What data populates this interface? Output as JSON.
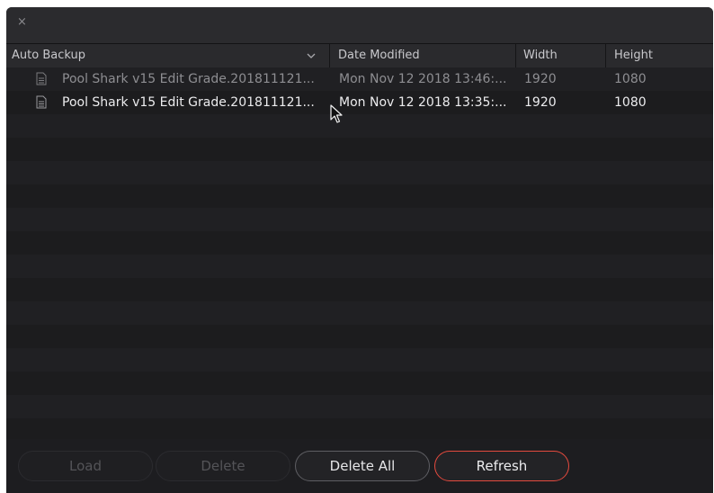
{
  "window": {
    "close_glyph": "×"
  },
  "table": {
    "columns": [
      {
        "label": "Auto Backup",
        "sortable": true
      },
      {
        "label": "Date Modified"
      },
      {
        "label": "Width"
      },
      {
        "label": "Height"
      }
    ],
    "sort_indicator": "chevron-down-icon",
    "rows": [
      {
        "name": "Pool Shark v15 Edit Grade.201811121...",
        "date_modified": "Mon Nov 12 2018 13:46:...",
        "width": "1920",
        "height": "1080",
        "icon": "document-icon",
        "selected": false
      },
      {
        "name": "Pool Shark v15 Edit Grade.201811121...",
        "date_modified": "Mon Nov 12 2018 13:35:...",
        "width": "1920",
        "height": "1080",
        "icon": "document-icon",
        "selected": true
      }
    ]
  },
  "buttons": {
    "load": "Load",
    "delete": "Delete",
    "delete_all": "Delete All",
    "refresh": "Refresh"
  },
  "colors": {
    "background": "#1c1c1e",
    "header": "#2a2a2d",
    "stripe_light": "#202023",
    "stripe_dark": "#1c1c1e",
    "refresh_accent": "#e44a3e"
  }
}
